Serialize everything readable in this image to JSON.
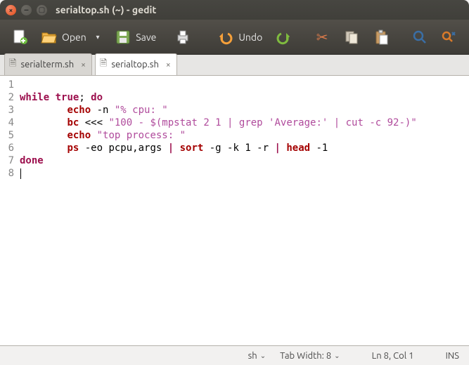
{
  "window": {
    "title": "serialtop.sh (~) - gedit"
  },
  "toolbar": {
    "open_label": "Open",
    "save_label": "Save",
    "undo_label": "Undo"
  },
  "tabs": [
    {
      "name": "serialterm.sh",
      "active": false
    },
    {
      "name": "serialtop.sh",
      "active": true
    }
  ],
  "editor": {
    "line_numbers": [
      "1",
      "2",
      "3",
      "4",
      "5",
      "6",
      "7",
      "8"
    ],
    "code": {
      "l1": "",
      "l2": {
        "kw1": "while",
        "kw2": "true",
        "p1": "; ",
        "kw3": "do"
      },
      "l3": {
        "indent": "        ",
        "cmd": "echo",
        "args": " -n ",
        "str": "\"% cpu: \""
      },
      "l4": {
        "indent": "        ",
        "cmd": "bc",
        "args": " <<< ",
        "str": "\"100 - $(mpstat 2 1 | grep 'Average:' | cut -c 92-)\""
      },
      "l5": {
        "indent": "        ",
        "cmd": "echo",
        "sp": " ",
        "str": "\"top process: \""
      },
      "l6": {
        "indent": "        ",
        "cmd": "ps",
        "args1": " -eo pcpu,args ",
        "pipe1": "|",
        "sp1": " ",
        "cmd2": "sort",
        "args2": " -g -k 1 -r ",
        "pipe2": "|",
        "sp2": " ",
        "cmd3": "head",
        "args3": " -1"
      },
      "l7": {
        "kw1": "done"
      },
      "l8": ""
    }
  },
  "status": {
    "language": "sh",
    "tab_width": "Tab Width: 8",
    "position": "Ln 8, Col 1",
    "mode": "INS"
  }
}
